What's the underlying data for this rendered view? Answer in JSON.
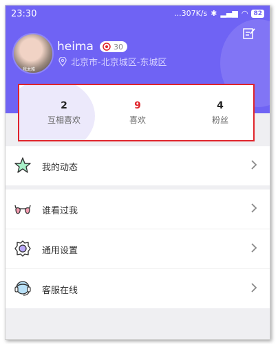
{
  "status_bar": {
    "time": "23:30",
    "network": "...307K/s",
    "battery": "82"
  },
  "profile": {
    "name": "heima",
    "avatar_caption": "我太难",
    "level": "30",
    "location": "北京市-北京城区-东城区"
  },
  "stats": [
    {
      "value": "2",
      "label": "互相喜欢"
    },
    {
      "value": "9",
      "label": "喜欢"
    },
    {
      "value": "4",
      "label": "粉丝"
    }
  ],
  "menu_top": [
    {
      "label": "我的动态",
      "icon": "star-icon"
    }
  ],
  "menu_main": [
    {
      "label": "谁看过我",
      "icon": "glasses-icon"
    },
    {
      "label": "通用设置",
      "icon": "gear-icon"
    },
    {
      "label": "客服在线",
      "icon": "headset-icon"
    }
  ],
  "colors": {
    "header": "#6f63f4",
    "highlight": "#e0242b",
    "stat_accent": "#e0242b"
  }
}
